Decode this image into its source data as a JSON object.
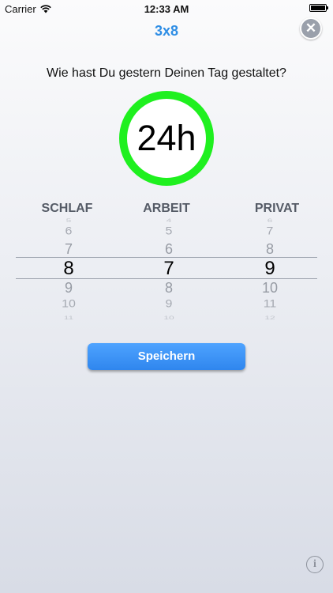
{
  "status_bar": {
    "carrier": "Carrier",
    "time": "12:33 AM"
  },
  "header": {
    "title": "3x8",
    "close_icon": "close-icon"
  },
  "question": "Wie hast Du gestern Deinen Tag gestaltet?",
  "total_hours": "24h",
  "colors": {
    "accent": "#2f8ee5",
    "ring": "#1ff01f",
    "button": "#3a93f5"
  },
  "picker": {
    "columns": [
      {
        "label": "SCHLAF",
        "values": [
          "5",
          "6",
          "7",
          "8",
          "9",
          "10",
          "11"
        ],
        "selected": "8"
      },
      {
        "label": "ARBEIT",
        "values": [
          "4",
          "5",
          "6",
          "7",
          "8",
          "9",
          "10"
        ],
        "selected": "7"
      },
      {
        "label": "PRIVAT",
        "values": [
          "6",
          "7",
          "8",
          "9",
          "10",
          "11",
          "12"
        ],
        "selected": "9"
      }
    ]
  },
  "save_button": "Speichern",
  "info_icon": "info-icon"
}
